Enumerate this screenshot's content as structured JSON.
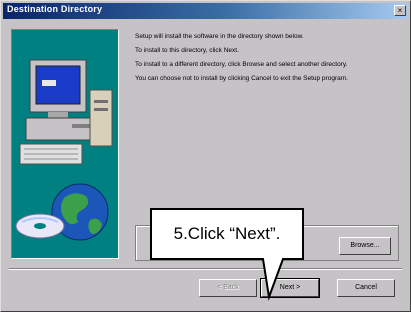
{
  "window": {
    "title": "Destination Directory",
    "close_glyph": "×"
  },
  "body": {
    "paragraphs": [
      "Setup will install the software in the directory shown below.",
      "To install to this directory, click Next.",
      "To install to a different directory, click Browse and select another directory.",
      "You can choose not to install by clicking Cancel to exit the Setup program."
    ]
  },
  "buttons": {
    "browse": "Browse...",
    "back": "< Back",
    "next": "Next >",
    "cancel": "Cancel"
  },
  "callout": {
    "text": "5.Click “Next”."
  },
  "colors": {
    "title_bar": "#0a246a",
    "window_face": "#c6c3c6",
    "illustration_bg": "#008080"
  },
  "icons": [
    "computer-monitor-icon",
    "desktop-computer-icon",
    "cd-disc-icon",
    "globe-icon",
    "close-icon"
  ]
}
